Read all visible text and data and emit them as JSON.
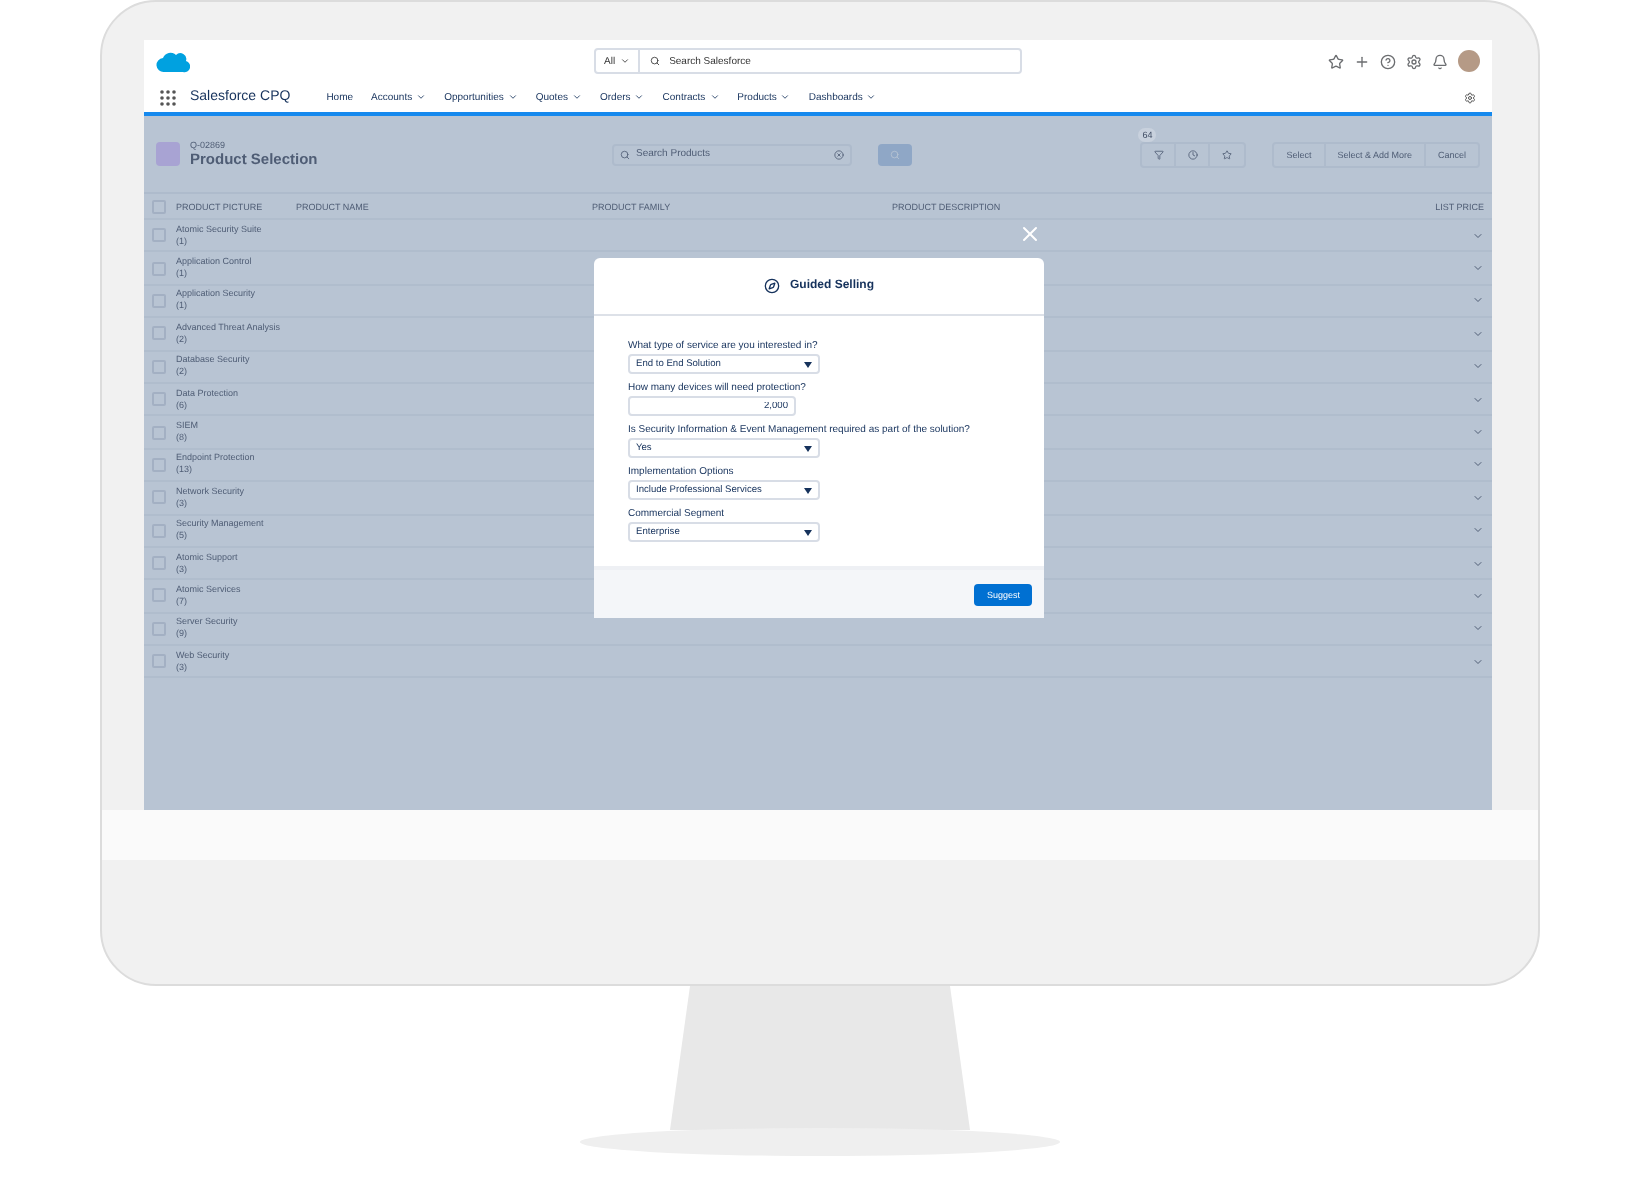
{
  "header": {
    "search_scope": "All",
    "search_placeholder": "Search Salesforce"
  },
  "app_name": "Salesforce CPQ",
  "nav": [
    {
      "label": "Home",
      "has_menu": false
    },
    {
      "label": "Accounts",
      "has_menu": true
    },
    {
      "label": "Opportunities",
      "has_menu": true
    },
    {
      "label": "Quotes",
      "has_menu": true
    },
    {
      "label": "Orders",
      "has_menu": true
    },
    {
      "label": "Contracts",
      "has_menu": true
    },
    {
      "label": "Products",
      "has_menu": true
    },
    {
      "label": "Dashboards",
      "has_menu": true
    }
  ],
  "page": {
    "record": "Q-02869",
    "title": "Product Selection",
    "search_placeholder": "Search Products",
    "filter_count": "64",
    "actions": [
      "Select",
      "Select & Add More",
      "Cancel"
    ]
  },
  "table": {
    "all_checked": false,
    "columns": [
      "PRODUCT PICTURE",
      "PRODUCT NAME",
      "PRODUCT FAMILY",
      "PRODUCT DESCRIPTION",
      "LIST PRICE"
    ],
    "rows": [
      {
        "name": "Atomic Security Suite",
        "count": "(1)",
        "checked": false
      },
      {
        "name": "Application Control",
        "count": "(1)",
        "checked": false
      },
      {
        "name": "Application Security",
        "count": "(1)",
        "checked": false
      },
      {
        "name": "Advanced Threat Analysis",
        "count": "(2)",
        "checked": false
      },
      {
        "name": "Database Security",
        "count": "(2)",
        "checked": false
      },
      {
        "name": "Data Protection",
        "count": "(6)",
        "checked": false
      },
      {
        "name": "SIEM",
        "count": "(8)",
        "checked": false
      },
      {
        "name": "Endpoint Protection",
        "count": "(13)",
        "checked": false
      },
      {
        "name": "Network Security",
        "count": "(3)",
        "checked": false
      },
      {
        "name": "Security Management",
        "count": "(5)",
        "checked": false
      },
      {
        "name": "Atomic Support",
        "count": "(3)",
        "checked": false
      },
      {
        "name": "Atomic Services",
        "count": "(7)",
        "checked": false
      },
      {
        "name": "Server Security",
        "count": "(9)",
        "checked": false
      },
      {
        "name": "Web Security",
        "count": "(3)",
        "checked": false
      }
    ]
  },
  "modal": {
    "title": "Guided Selling",
    "submit": "Suggest",
    "questions": [
      {
        "label": "What type of service are you interested in?",
        "kind": "select",
        "value": "End to End Solution"
      },
      {
        "label": "How many devices will need protection?",
        "kind": "number",
        "value": "2,000"
      },
      {
        "label": "Is Security Information & Event Management required as part of the solution?",
        "kind": "select",
        "value": "Yes"
      },
      {
        "label": "Implementation Options",
        "kind": "select",
        "value": "Include Professional Services"
      },
      {
        "label": "Commercial Segment",
        "kind": "select",
        "value": "Enterprise"
      }
    ]
  }
}
